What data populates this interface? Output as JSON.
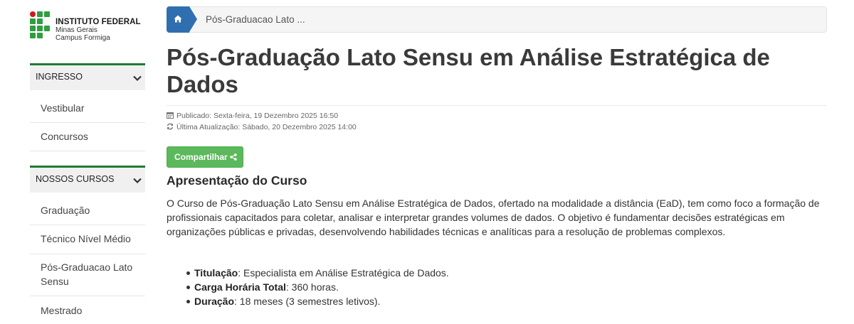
{
  "logo": {
    "title": "INSTITUTO FEDERAL",
    "line1": "Minas Gerais",
    "line2": "Campus Formiga",
    "colors": {
      "green": "#2f9e41",
      "red": "#cd191e"
    }
  },
  "sidebar": {
    "sections": [
      {
        "label": "INGRESSO",
        "items": [
          {
            "label": "Vestibular"
          },
          {
            "label": "Concursos"
          }
        ]
      },
      {
        "label": "NOSSOS CURSOS",
        "items": [
          {
            "label": "Graduação"
          },
          {
            "label": "Técnico Nível Médio"
          },
          {
            "label": "Pós-Graduacao Lato Sensu"
          },
          {
            "label": "Mestrado"
          }
        ]
      }
    ],
    "accent": "#1e7b32"
  },
  "breadcrumb": {
    "home_icon": "home-icon",
    "current": "Pós-Graduacao Lato ..."
  },
  "article": {
    "title": "Pós-Graduação Lato Sensu em Análise Estratégica de Dados",
    "published": "Publicado: Sexta-feira, 19 Dezembro 2025 16:50",
    "updated": "Última Atualização: Sábado, 20 Dezembro 2025 14:00",
    "share_label": "Compartilhar",
    "section_title": "Apresentação do Curso",
    "intro": "O Curso de Pós-Graduação Lato Sensu em Análise Estratégica de Dados, ofertado na modalidade a distância (EaD), tem como foco a formação de profissionais capacitados para coletar, analisar e interpretar grandes volumes de dados. O objetivo é fundamentar decisões estratégicas em organizações públicas e privadas, desenvolvendo habilidades técnicas e analíticas para a resolução de problemas complexos.",
    "details": [
      {
        "label": "Titulação",
        "value": ": Especialista em Análise Estratégica de Dados."
      },
      {
        "label": "Carga Horária Total",
        "value": ": 360 horas."
      },
      {
        "label": "Duração",
        "value": ": 18 meses (3 semestres letivos)."
      }
    ],
    "colors": {
      "share": "#5cb85c",
      "breadcrumb_home": "#2f6fb0"
    }
  }
}
